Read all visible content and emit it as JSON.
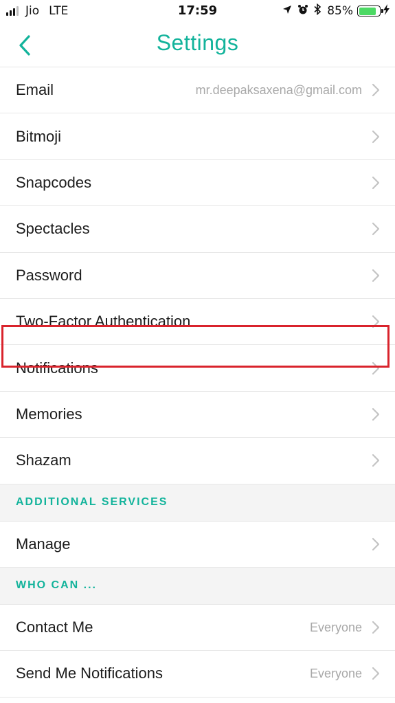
{
  "status_bar": {
    "carrier": "Jio",
    "network": "LTE",
    "time": "17:59",
    "battery_percent": "85%",
    "battery_level": 0.85,
    "icons": [
      "location-arrow-icon",
      "alarm-icon",
      "bluetooth-icon",
      "charging-bolt-icon"
    ]
  },
  "nav": {
    "title": "Settings",
    "back_icon": "chevron-left-icon"
  },
  "rows_group1": [
    {
      "label": "Email",
      "value": "mr.deepaksaxena@gmail.com"
    },
    {
      "label": "Bitmoji",
      "value": ""
    },
    {
      "label": "Snapcodes",
      "value": ""
    },
    {
      "label": "Spectacles",
      "value": ""
    },
    {
      "label": "Password",
      "value": ""
    },
    {
      "label": "Two-Factor Authentication",
      "value": ""
    },
    {
      "label": "Notifications",
      "value": ""
    },
    {
      "label": "Memories",
      "value": ""
    },
    {
      "label": "Shazam",
      "value": ""
    }
  ],
  "section_additional": {
    "title": "ADDITIONAL SERVICES"
  },
  "rows_group2": [
    {
      "label": "Manage",
      "value": ""
    }
  ],
  "section_who_can": {
    "title": "WHO CAN ..."
  },
  "rows_group3": [
    {
      "label": "Contact Me",
      "value": "Everyone"
    },
    {
      "label": "Send Me Notifications",
      "value": "Everyone"
    }
  ],
  "colors": {
    "accent": "#12b39b",
    "highlight": "#d9232c",
    "chevron": "#c4c4c4",
    "battery": "#4cd964"
  }
}
